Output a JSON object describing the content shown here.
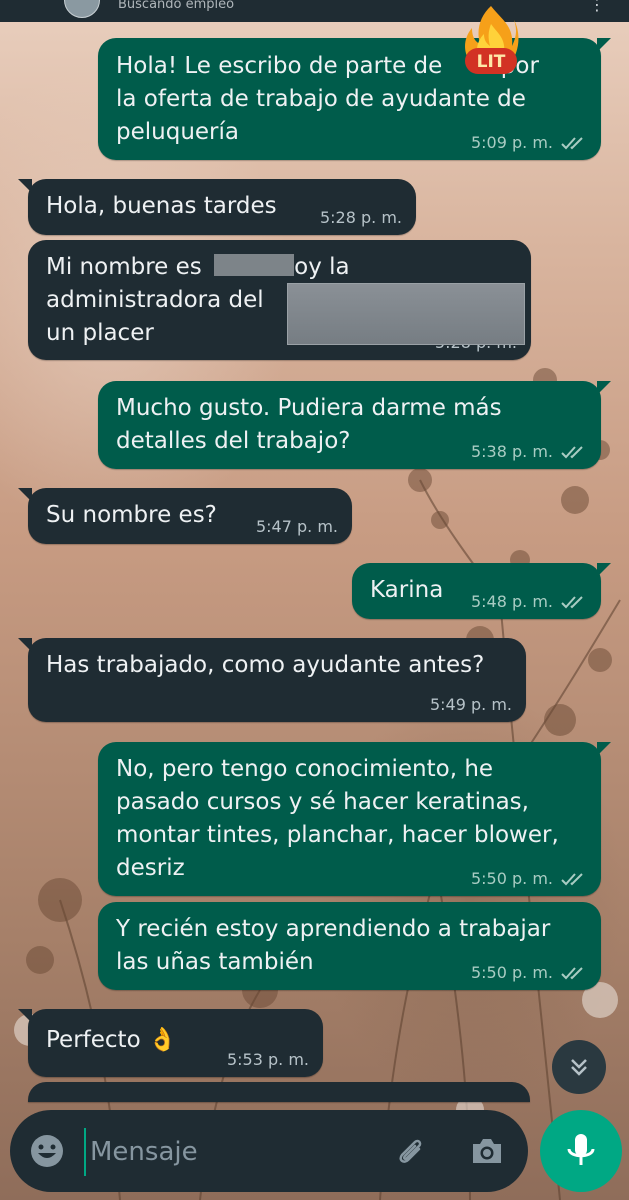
{
  "header": {
    "contact_name": "Buscando empleo",
    "menu_glyph": "⋮"
  },
  "sticker": {
    "text": "LIT"
  },
  "messages": [
    {
      "dir": "out",
      "text": "Hola! Le escribo de parte de        por\nla oferta de trabajo de ayudante de\npeluquería",
      "time": "5:09 p. m.",
      "read": true
    },
    {
      "dir": "in",
      "text": "Hola, buenas tardes",
      "time": "5:28 p. m."
    },
    {
      "dir": "in",
      "text": "Mi nombre es           soy la\nadministradora del\nun placer",
      "time": "5:28 p. m."
    },
    {
      "dir": "out",
      "text": "Mucho gusto. Pudiera darme más\ndetalles del trabajo?",
      "time": "5:38 p. m.",
      "read": true
    },
    {
      "dir": "in",
      "text": "Su nombre es?",
      "time": "5:47 p. m."
    },
    {
      "dir": "out",
      "text": "Karina",
      "time": "5:48 p. m.",
      "read": true
    },
    {
      "dir": "in",
      "text": "Has trabajado, como ayudante antes?",
      "time": "5:49 p. m."
    },
    {
      "dir": "out",
      "text": "No, pero tengo conocimiento, he\npasado cursos y sé hacer keratinas,\nmontar tintes, planchar, hacer blower,\ndesriz",
      "time": "5:50 p. m.",
      "read": true
    },
    {
      "dir": "out",
      "text": "Y recién estoy aprendiendo a trabajar\nlas uñas también",
      "time": "5:50 p. m.",
      "read": true
    },
    {
      "dir": "in",
      "text": "Perfecto 👌",
      "time": "5:53 p. m."
    }
  ],
  "composer": {
    "placeholder": "Mensaje",
    "icons": [
      "emoji-icon",
      "attach-icon",
      "camera-icon",
      "mic-icon"
    ]
  },
  "colors": {
    "incoming_bubble": "#1f2c33",
    "outgoing_bubble": "#005c4b",
    "accent": "#00a884",
    "read_ticks": "#a9ccc3"
  }
}
